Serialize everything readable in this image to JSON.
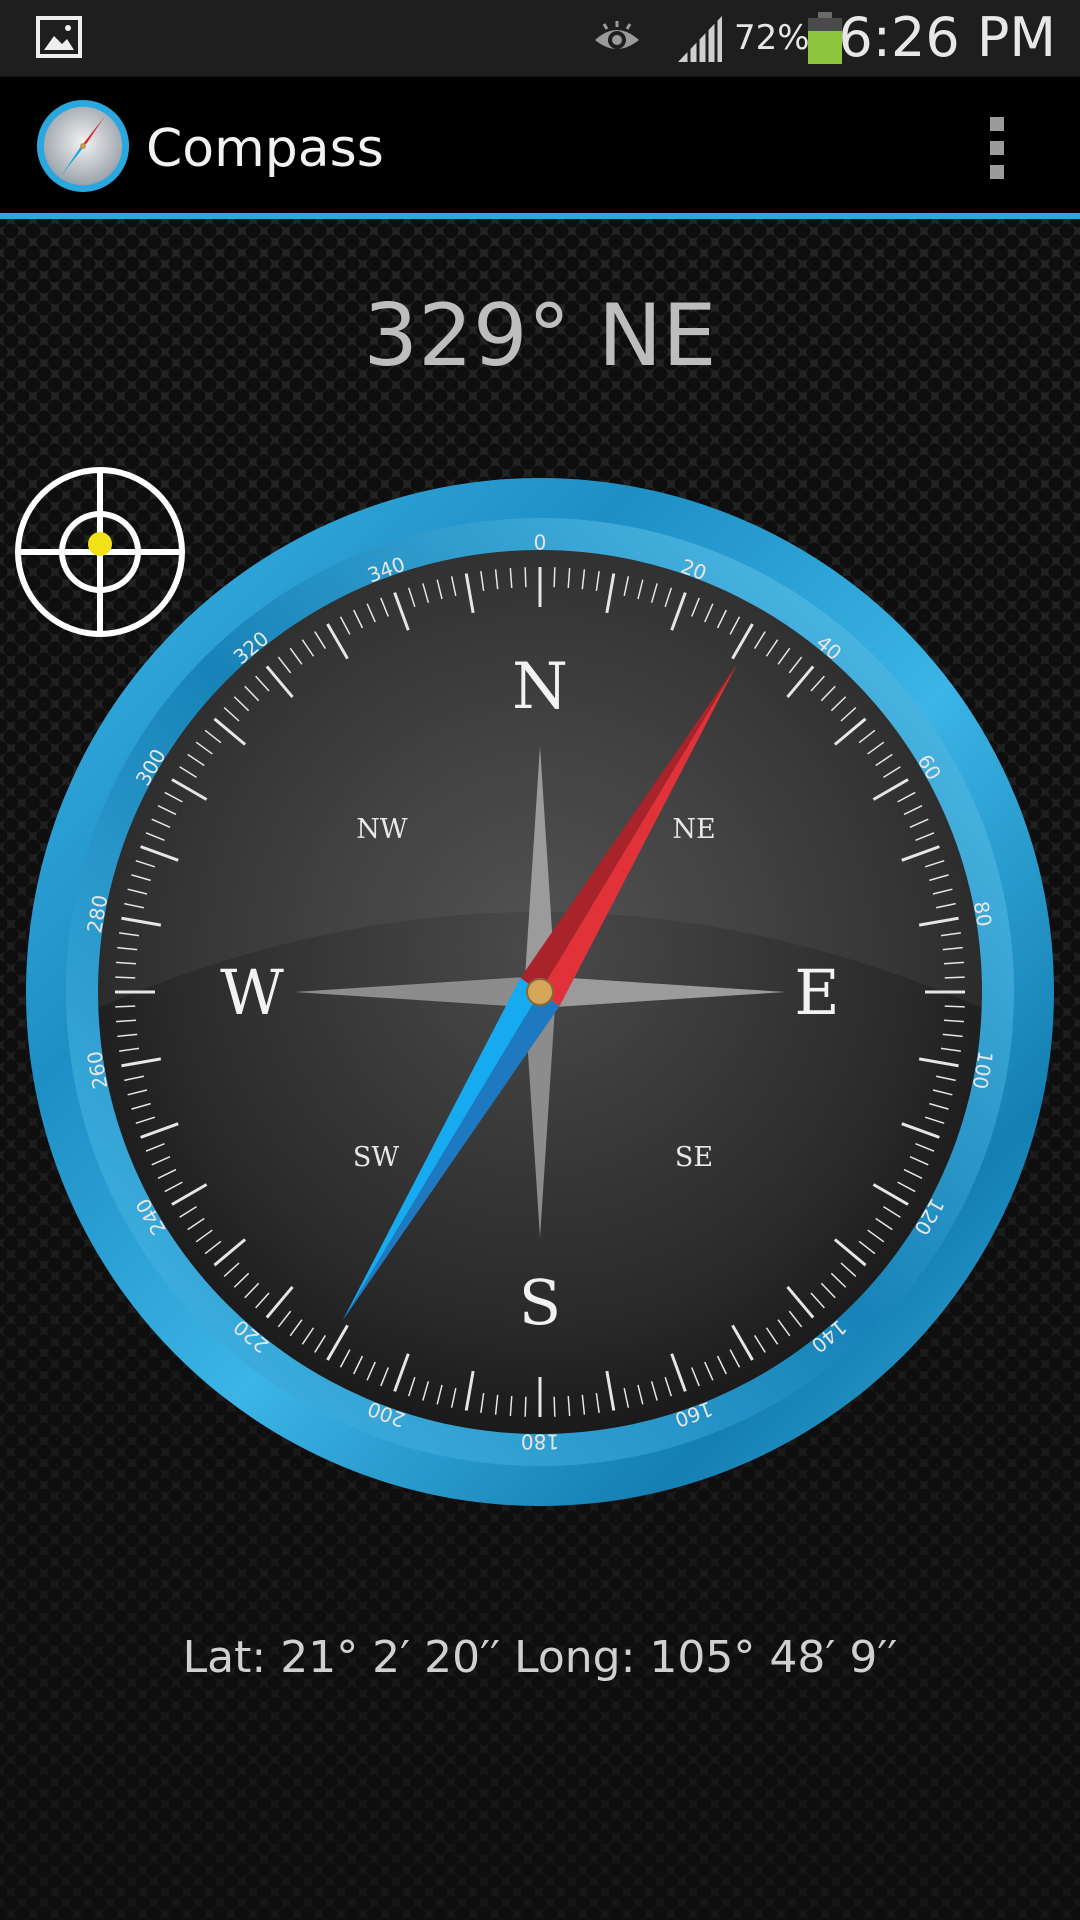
{
  "status_bar": {
    "battery_percent": "72%",
    "time": "6:26 PM",
    "icons": [
      "gallery-icon",
      "eye-icon",
      "signal-icon",
      "battery-icon"
    ]
  },
  "action_bar": {
    "title": "Compass",
    "icons": [
      "compass-app-icon",
      "overflow-menu-icon"
    ]
  },
  "heading": {
    "text": "329° NE",
    "degrees": 329
  },
  "compass": {
    "cardinals": {
      "N": "N",
      "E": "E",
      "S": "S",
      "W": "W"
    },
    "intercardinals": {
      "NE": "NE",
      "SE": "SE",
      "SW": "SW",
      "NW": "NW"
    },
    "scale_labels": [
      "0",
      "20",
      "40",
      "60",
      "80",
      "100",
      "120",
      "140",
      "160",
      "180",
      "200",
      "220",
      "240",
      "260",
      "280",
      "300",
      "320",
      "340"
    ],
    "needle_bearing": 31,
    "colors": {
      "ring": "#2ba7df",
      "needle_north": "#d32a2f",
      "needle_south": "#1aa3e6",
      "accent_line": "#2ba7df"
    }
  },
  "coordinates": {
    "text": "Lat: 21° 2′ 20′′ Long: 105° 48′ 9′′"
  }
}
